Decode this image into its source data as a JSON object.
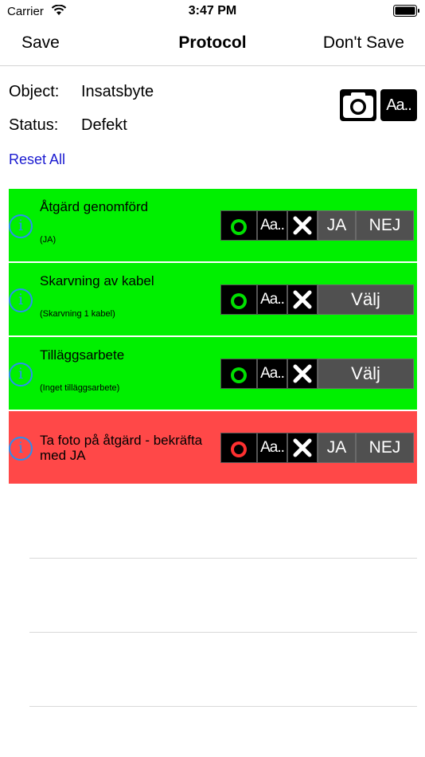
{
  "status_bar": {
    "carrier": "Carrier",
    "time": "3:47 PM"
  },
  "nav": {
    "left_button": "Save",
    "title": "Protocol",
    "right_button": "Don't Save"
  },
  "info": {
    "object_label": "Object:",
    "object_value": "Insatsbyte",
    "status_label": "Status:",
    "status_value": "Defekt",
    "text_icon_label": "Aa.."
  },
  "reset_all": "Reset All",
  "items": [
    {
      "title": "Åtgärd genomförd",
      "subtitle": "(JA)",
      "color": "#00f000",
      "camera_ring_color": "#00e000",
      "text_label": "Aa..",
      "type": "yesno",
      "yes_label": "JA",
      "no_label": "NEJ"
    },
    {
      "title": "Skarvning av kabel",
      "subtitle": "(Skarvning 1 kabel)",
      "color": "#00f000",
      "camera_ring_color": "#00e000",
      "text_label": "Aa..",
      "type": "choice",
      "choice_label": "Välj"
    },
    {
      "title": "Tilläggsarbete",
      "subtitle": "(Inget tilläggsarbete)",
      "color": "#00f000",
      "camera_ring_color": "#00e000",
      "text_label": "Aa..",
      "type": "choice",
      "choice_label": "Välj"
    },
    {
      "title": "Ta foto på åtgärd - bekräfta med JA",
      "subtitle": "",
      "color": "#ff4848",
      "camera_ring_color": "#ff3030",
      "text_label": "Aa..",
      "type": "yesno",
      "yes_label": "JA",
      "no_label": "NEJ"
    }
  ],
  "colors": {
    "link": "#1a1ad0",
    "info_icon": "#2a8ff0",
    "ok_green": "#00f000",
    "alert_red": "#ff4848"
  },
  "icons": {
    "info": "info-circle-icon",
    "camera": "camera-icon",
    "text": "text-note-icon",
    "clear": "close-icon"
  }
}
